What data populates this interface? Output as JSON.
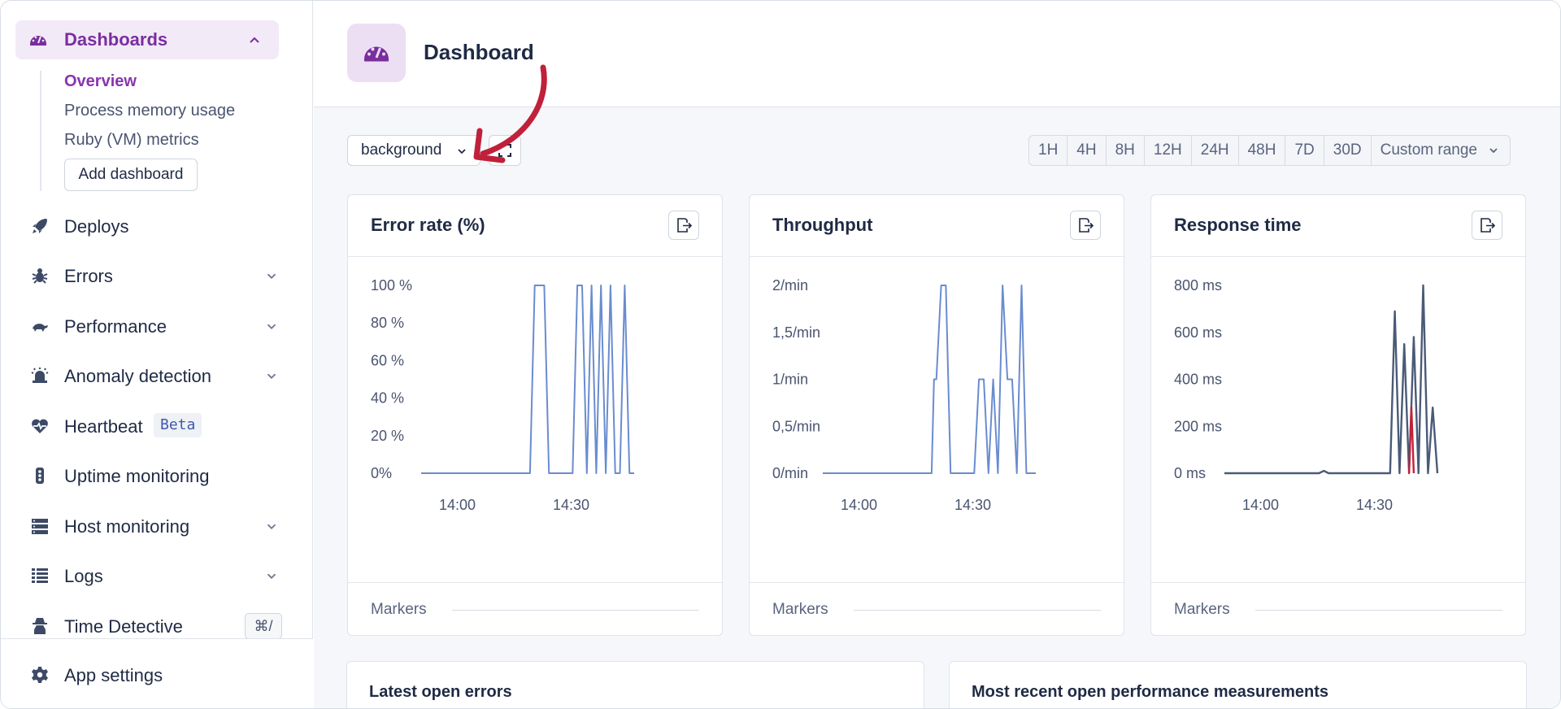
{
  "sidebar": {
    "active": {
      "label": "Dashboards",
      "icon": "gauge-icon"
    },
    "subitems": [
      {
        "label": "Overview",
        "active": true
      },
      {
        "label": "Process memory usage",
        "active": false
      },
      {
        "label": "Ruby (VM) metrics",
        "active": false
      }
    ],
    "add_dashboard": "Add dashboard",
    "items": [
      {
        "label": "Deploys",
        "icon": "rocket-icon"
      },
      {
        "label": "Errors",
        "icon": "bug-icon"
      },
      {
        "label": "Performance",
        "icon": "turtle-icon"
      },
      {
        "label": "Anomaly detection",
        "icon": "siren-icon"
      },
      {
        "label": "Heartbeat",
        "icon": "heart-pulse-icon",
        "badge": "Beta"
      },
      {
        "label": "Uptime monitoring",
        "icon": "traffic-light-icon"
      },
      {
        "label": "Host monitoring",
        "icon": "server-icon"
      },
      {
        "label": "Logs",
        "icon": "list-icon"
      },
      {
        "label": "Time Detective",
        "icon": "detective-icon",
        "shortcut": "⌘/"
      }
    ],
    "settings": {
      "label": "App settings",
      "icon": "gear-icon"
    }
  },
  "header": {
    "title": "Dashboard",
    "icon": "gauge-icon"
  },
  "toolbar": {
    "namespace_select": "background",
    "ranges": [
      "1H",
      "4H",
      "8H",
      "12H",
      "24H",
      "48H",
      "7D",
      "30D"
    ],
    "custom_range": "Custom range"
  },
  "colors": {
    "accent": "#8a34b0",
    "line": "#6a8ccf",
    "line_dark": "#4a5a78",
    "annotation": "#c0203a"
  },
  "cards": [
    {
      "title": "Error rate (%)",
      "markers": "Markers"
    },
    {
      "title": "Throughput",
      "markers": "Markers"
    },
    {
      "title": "Response time",
      "markers": "Markers"
    }
  ],
  "chart_data": [
    {
      "type": "line",
      "title": "Error rate (%)",
      "yticks": [
        "100 %",
        "80 %",
        "60 %",
        "40 %",
        "20 %",
        "0%"
      ],
      "xticks": [
        "14:00",
        "14:30"
      ],
      "ylim": [
        0,
        100
      ],
      "series": [
        {
          "x": [
            0,
            23,
            24,
            26,
            27,
            28,
            32,
            33,
            34,
            35,
            36,
            37,
            38,
            39,
            40,
            41,
            42,
            43,
            44,
            45
          ],
          "values": [
            0,
            0,
            100,
            100,
            0,
            0,
            0,
            100,
            100,
            0,
            100,
            0,
            100,
            0,
            100,
            0,
            0,
            100,
            0,
            0
          ]
        }
      ]
    },
    {
      "type": "line",
      "title": "Throughput",
      "yticks": [
        "2/min",
        "1,5/min",
        "1/min",
        "0,5/min",
        "0/min"
      ],
      "xticks": [
        "14:00",
        "14:30"
      ],
      "ylim": [
        0,
        2
      ],
      "series": [
        {
          "x": [
            0,
            23,
            23.5,
            24,
            25,
            26,
            27,
            32,
            33,
            34,
            35,
            36,
            37,
            38,
            39,
            40,
            41,
            42,
            43,
            44,
            45
          ],
          "values": [
            0,
            0,
            1,
            1,
            2,
            2,
            0,
            0,
            1,
            1,
            0,
            1,
            0,
            2,
            1,
            1,
            0,
            2,
            0,
            0,
            0
          ]
        }
      ]
    },
    {
      "type": "line",
      "title": "Response time",
      "yticks": [
        "800 ms",
        "600 ms",
        "400 ms",
        "200 ms",
        "0 ms"
      ],
      "xticks": [
        "14:00",
        "14:30"
      ],
      "ylim": [
        0,
        800
      ],
      "series": [
        {
          "x": [
            0,
            20,
            21,
            22,
            35,
            36,
            37,
            38,
            39,
            40,
            41,
            42,
            43,
            44,
            45
          ],
          "values": [
            0,
            0,
            10,
            0,
            0,
            690,
            0,
            550,
            0,
            580,
            0,
            800,
            0,
            280,
            0
          ]
        },
        {
          "x": [
            39,
            39.5,
            40
          ],
          "values": [
            0,
            280,
            0
          ]
        }
      ]
    }
  ],
  "bottom": {
    "left_title": "Latest open errors",
    "right_title": "Most recent open performance measurements"
  }
}
